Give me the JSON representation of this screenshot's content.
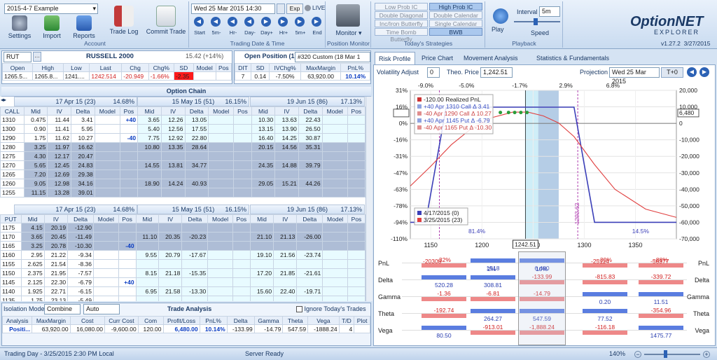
{
  "ribbon": {
    "file_select": "2015-4-7 Example",
    "account_title": "Account",
    "buttons": {
      "settings": "Settings",
      "import": "Import",
      "reports": "Reports",
      "trade_log": "Trade Log",
      "commit_trade": "Commit Trade"
    },
    "trading_title": "Trading Date & Time",
    "datetime": "Wed 25 Mar  2015 14:30",
    "exp": "Exp",
    "live": "LIVE",
    "step_labels": [
      "Start",
      "5m-",
      "Hr-",
      "Day-",
      "Day+",
      "Hr+",
      "5m+",
      "End"
    ],
    "monitor_title": "Position Monitor",
    "monitor_label": "Monitor",
    "strategies_title": "Today's Strategies",
    "strategies": [
      [
        "Low Prob IC",
        "High Prob IC"
      ],
      [
        "Double Diagonal",
        "Double Calendar"
      ],
      [
        "Inc/Iron Butterfly",
        "Single Calendar"
      ],
      [
        "Time Bomb Butterfly",
        "BWB"
      ]
    ],
    "playback_title": "Playback",
    "play": "Play",
    "interval_label": "Interval",
    "interval": "5m",
    "speed": "Speed",
    "logo1": "OptionNET",
    "logo2": "EXPLORER",
    "version": "v1.27.2",
    "version_date": "3/27/2015"
  },
  "quote": {
    "symbol": "RUT",
    "name": "RUSSELL 2000",
    "change_summary": "15.42 (+14%)",
    "headers": [
      "Open",
      "High",
      "Low",
      "Last",
      "Chg",
      "Chg%",
      "SD",
      "Model",
      "Pos"
    ],
    "values": [
      "1265.5...",
      "1265.8...",
      "1241....",
      "1242.514",
      "-20.949",
      "-1.66%",
      "-2.35",
      "",
      ""
    ]
  },
  "position": {
    "title": "Open Position (1)",
    "name": "#320 Custom (18 Mar 1",
    "headers": [
      "DIT",
      "SD",
      "IVChg%",
      "MaxMargin",
      "PnL%"
    ],
    "values": [
      "7",
      "0.14",
      "-7.50%",
      "63,920.00",
      "10.14%"
    ]
  },
  "chain": {
    "title": "Option Chain",
    "expirations": [
      {
        "label": "17 Apr 15 (23)",
        "iv": "14.68%"
      },
      {
        "label": "15 May 15 (51)",
        "iv": "16.15%"
      },
      {
        "label": "19 Jun 15 (86)",
        "iv": "17.13%"
      }
    ],
    "call_cols": [
      "CALL",
      "Mid",
      "IV",
      "Delta",
      "Model",
      "Pos"
    ],
    "put_cols": [
      "PUT",
      "Mid",
      "IV",
      "Delta",
      "Model",
      "Pos"
    ],
    "sub_cols": [
      "Mid",
      "IV",
      "Delta",
      "Model",
      "Pos"
    ],
    "calls": [
      {
        "strike": "1310",
        "e1": [
          "0.475",
          "11.44",
          "3.41",
          "",
          "+40"
        ],
        "e2": [
          "3.65",
          "12.26",
          "13.05",
          "",
          ""
        ],
        "e3": [
          "10.30",
          "13.63",
          "22.43",
          "",
          ""
        ]
      },
      {
        "strike": "1300",
        "e1": [
          "0.90",
          "11.41",
          "5.95",
          "",
          ""
        ],
        "e2": [
          "5.40",
          "12.56",
          "17.55",
          "",
          ""
        ],
        "e3": [
          "13.15",
          "13.90",
          "26.50",
          "",
          ""
        ]
      },
      {
        "strike": "1290",
        "e1": [
          "1.75",
          "11.62",
          "10.27",
          "",
          "-40"
        ],
        "e2": [
          "7.75",
          "12.92",
          "22.80",
          "",
          ""
        ],
        "e3": [
          "16.40",
          "14.25",
          "30.87",
          "",
          ""
        ]
      },
      {
        "strike": "1280",
        "e1": [
          "3.25",
          "11.97",
          "16.62",
          "",
          ""
        ],
        "e2": [
          "10.80",
          "13.35",
          "28.64",
          "",
          ""
        ],
        "e3": [
          "20.15",
          "14.56",
          "35.31",
          "",
          ""
        ]
      },
      {
        "strike": "1275",
        "e1": [
          "4.30",
          "12.17",
          "20.47",
          "",
          ""
        ],
        "e2": [
          "",
          "",
          "",
          "",
          ""
        ],
        "e3": [
          "",
          "",
          "",
          "",
          ""
        ]
      },
      {
        "strike": "1270",
        "e1": [
          "5.65",
          "12.45",
          "24.83",
          "",
          ""
        ],
        "e2": [
          "14.55",
          "13.81",
          "34.77",
          "",
          ""
        ],
        "e3": [
          "24.35",
          "14.88",
          "39.79",
          "",
          ""
        ]
      },
      {
        "strike": "1265",
        "e1": [
          "7.20",
          "12.69",
          "29.38",
          "",
          ""
        ],
        "e2": [
          "",
          "",
          "",
          "",
          ""
        ],
        "e3": [
          "",
          "",
          "",
          "",
          ""
        ]
      },
      {
        "strike": "1260",
        "e1": [
          "9.05",
          "12.98",
          "34.16",
          "",
          ""
        ],
        "e2": [
          "18.90",
          "14.24",
          "40.93",
          "",
          ""
        ],
        "e3": [
          "29.05",
          "15.21",
          "44.26",
          "",
          ""
        ]
      },
      {
        "strike": "1255",
        "e1": [
          "11.15",
          "13.28",
          "39.01",
          "",
          ""
        ],
        "e2": [
          "",
          "",
          "",
          "",
          ""
        ],
        "e3": [
          "",
          "",
          "",
          "",
          ""
        ]
      }
    ],
    "puts": [
      {
        "strike": "1175",
        "e1": [
          "4.15",
          "20.19",
          "-12.90",
          "",
          ""
        ],
        "e2": [
          "",
          "",
          "",
          "",
          ""
        ],
        "e3": [
          "",
          "",
          "",
          "",
          ""
        ]
      },
      {
        "strike": "1170",
        "e1": [
          "3.65",
          "20.45",
          "-11.49",
          "",
          ""
        ],
        "e2": [
          "11.10",
          "20.35",
          "-20.23",
          "",
          ""
        ],
        "e3": [
          "21.10",
          "21.13",
          "-26.00",
          "",
          ""
        ]
      },
      {
        "strike": "1165",
        "e1": [
          "3.25",
          "20.78",
          "-10.30",
          "",
          "-40"
        ],
        "e2": [
          "",
          "",
          "",
          "",
          ""
        ],
        "e3": [
          "",
          "",
          "",
          "",
          ""
        ]
      },
      {
        "strike": "1160",
        "e1": [
          "2.95",
          "21.22",
          "-9.34",
          "",
          ""
        ],
        "e2": [
          "9.55",
          "20.79",
          "-17.67",
          "",
          ""
        ],
        "e3": [
          "19.10",
          "21.56",
          "-23.74",
          "",
          ""
        ]
      },
      {
        "strike": "1155",
        "e1": [
          "2.625",
          "21.54",
          "-8.36",
          "",
          ""
        ],
        "e2": [
          "",
          "",
          "",
          "",
          ""
        ],
        "e3": [
          "",
          "",
          "",
          "",
          ""
        ]
      },
      {
        "strike": "1150",
        "e1": [
          "2.375",
          "21.95",
          "-7.57",
          "",
          ""
        ],
        "e2": [
          "8.15",
          "21.18",
          "-15.35",
          "",
          ""
        ],
        "e3": [
          "17.20",
          "21.85",
          "-21.61",
          "",
          ""
        ]
      },
      {
        "strike": "1145",
        "e1": [
          "2.125",
          "22.30",
          "-6.79",
          "",
          "+40"
        ],
        "e2": [
          "",
          "",
          "",
          "",
          ""
        ],
        "e3": [
          "",
          "",
          "",
          "",
          ""
        ]
      },
      {
        "strike": "1140",
        "e1": [
          "1.925",
          "22.71",
          "-6.15",
          "",
          ""
        ],
        "e2": [
          "6.95",
          "21.58",
          "-13.30",
          "",
          ""
        ],
        "e3": [
          "15.60",
          "22.40",
          "-19.71",
          "",
          ""
        ]
      },
      {
        "strike": "1135",
        "e1": [
          "1.75",
          "23.13",
          "-5.49",
          "",
          ""
        ],
        "e2": [
          "",
          "",
          "",
          "",
          ""
        ],
        "e3": [
          "",
          "",
          "",
          "",
          ""
        ]
      }
    ]
  },
  "analysis": {
    "isolation_label": "Isolation Mode",
    "isolation_value": "Combine",
    "auto": "Auto",
    "title": "Trade Analysis",
    "ignore": "Ignore Today's Trades",
    "headers": [
      "Analysis",
      "MaxMargin",
      "Cost",
      "Curr Cost",
      "Com",
      "Profit/Loss",
      "PnL%",
      "Delta",
      "Gamma",
      "Theta",
      "Vega",
      "T/D",
      "Plot"
    ],
    "values": [
      "Positi...",
      "63,920.00",
      "16,080.00",
      "-9,600.00",
      "120.00",
      "6,480.00",
      "10.14%",
      "-133.99",
      "-14.79",
      "547.59",
      "-1888.24",
      "4",
      ""
    ]
  },
  "tabs": [
    "Risk Profile",
    "Price Chart",
    "Movement Analysis",
    "Statistics & Fundamentals"
  ],
  "risk": {
    "vol_adjust_label": "Volatility Adjust",
    "vol_adjust": "0",
    "theo_label": "Theo. Price",
    "theo_price": "1,242.51",
    "projection_label": "Projection",
    "projection_date": "Wed 25 Mar  2015",
    "t0": "T+0",
    "price_marker": "1242.51",
    "current_pnl_box": "6,480",
    "legend": [
      "-120.00 Realized PnL",
      "+40 Apr 1310 Call Δ 3.41",
      "-40 Apr 1290 Call Δ 10.27",
      "+40 Apr 1145 Put Δ -6.79",
      "-40 Apr 1165 Put Δ -10.30"
    ],
    "legend2": [
      "4/17/2015 (0)",
      "3/25/2015 (23)"
    ],
    "labels": {
      "pct_left": "81.4%",
      "pct_right": "14.5%",
      "strike_label": "1293.62"
    }
  },
  "chart_data": {
    "type": "line",
    "title": "",
    "xlabel": "",
    "ylabel": "",
    "x_ticks_bottom": [
      1150,
      1200,
      1250,
      1300,
      1350
    ],
    "x_ticks_top": [
      "-9.0%",
      "-5.0%",
      "-1.7%",
      "2.9%",
      "6.8%"
    ],
    "y_left_ticks": [
      "31%",
      "16%",
      "0%",
      "-16%",
      "-31%",
      "-47%",
      "-63%",
      "-78%",
      "-94%",
      "-110%"
    ],
    "y_right_ticks": [
      20000,
      10000,
      0,
      -10000,
      -20000,
      -30000,
      -40000,
      -50000,
      -60000,
      -70000
    ],
    "xlim": [
      1130,
      1390
    ],
    "ylim": [
      -70000,
      20000
    ],
    "series": [
      {
        "name": "4/17/2015 (0)",
        "color": "#3b3fb8",
        "x": [
          1130,
          1145,
          1165,
          1290,
          1310,
          1390
        ],
        "y": [
          -60000,
          -60000,
          9800,
          9800,
          -60000,
          -60000
        ]
      },
      {
        "name": "3/25/2015 (23)",
        "color": "#e04040",
        "x": [
          1130,
          1150,
          1170,
          1190,
          1210,
          1230,
          1245,
          1260,
          1275,
          1290,
          1310,
          1330,
          1360,
          1390
        ],
        "y": [
          -38000,
          -26000,
          -13000,
          -3000,
          3500,
          6800,
          6800,
          4500,
          200,
          -8000,
          -25000,
          -40000,
          -52000,
          -57000
        ]
      }
    ],
    "vertical_lines": [
      1158.4,
      1293.62
    ],
    "current_price": 1242.51
  },
  "greeks": {
    "rows": [
      "PnL",
      "Delta",
      "Gamma",
      "Theta",
      "Vega"
    ],
    "values": [
      [
        "-32%",
        "1518",
        "6,480",
        "-39%",
        "-88%"
      ],
      [
        "520.28",
        "308.81",
        "-133.99",
        "-815.83",
        "-339.72"
      ],
      [
        "-1.36",
        "-6.81",
        "-14.79",
        "0.20",
        "11.51"
      ],
      [
        "-192.74",
        "264.27",
        "547.59",
        "77.52",
        "-354.96"
      ],
      [
        "80.50",
        "-913.01",
        "-1,888.24",
        "-116.18",
        "1475.77"
      ]
    ],
    "extra": {
      "pnl1": "-20308",
      "pnl2": "2%",
      "pnl_center_pct": "10%",
      "pnl4": "-25114",
      "pnl5": "-56377"
    }
  },
  "status": {
    "left": "Trading Day - 3/25/2015 2:30 PM Local",
    "center": "Server Ready",
    "zoom": "140%"
  }
}
